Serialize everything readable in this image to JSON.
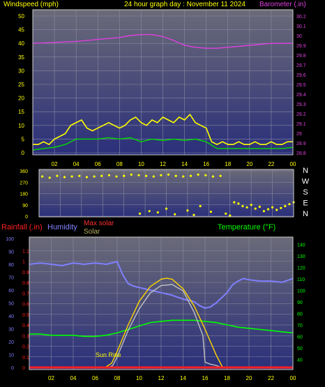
{
  "header": {
    "left_label": "Windspeed (mph)",
    "title": "24 hour graph day : November 11 2024",
    "right_label": "Barometer (.in)"
  },
  "colors": {
    "windspeed": "#ffff00",
    "wind_average": "#00dd00",
    "barometer": "#e040e0",
    "wind_direction": "#ffff00",
    "rainfall": "#ff2020",
    "humidity": "#8080ff",
    "max_solar": "#ffd700",
    "solar": "#c0c0c0",
    "temperature": "#00ff00",
    "plot_top": "#6a6a78",
    "plot_bottom": "#2a2f7a"
  },
  "x_axis_labels": [
    "02",
    "04",
    "06",
    "08",
    "10",
    "12",
    "14",
    "16",
    "18",
    "20",
    "22",
    "00"
  ],
  "chart_data": [
    {
      "type": "line",
      "panel": "wind_barometer",
      "x_unit": "hour",
      "xlim": [
        0,
        24
      ],
      "y_left_label": "Windspeed (mph)",
      "ylim_left": [
        0,
        50
      ],
      "y_left_ticks": [
        "0",
        "5",
        "10",
        "15",
        "20",
        "25",
        "30",
        "35",
        "40",
        "45",
        "50"
      ],
      "y_right_label": "Barometer (.in)",
      "ylim_right": [
        28.8,
        30.2
      ],
      "y_right_ticks": [
        "28.8",
        "28.9",
        "29",
        "29.1",
        "29.2",
        "29.3",
        "29.4",
        "29.5",
        "29.6",
        "29.7",
        "29.8",
        "29.9",
        "30",
        "30.1",
        "30.2"
      ],
      "series": [
        {
          "name": "Windspeed (mph)",
          "axis": "left",
          "x": [
            0,
            0.5,
            1,
            1.5,
            2,
            2.5,
            3,
            3.5,
            4,
            4.5,
            5,
            5.5,
            6,
            6.5,
            7,
            7.5,
            8,
            8.5,
            9,
            9.5,
            10,
            10.5,
            11,
            11.5,
            12,
            12.5,
            13,
            13.5,
            14,
            14.5,
            15,
            15.5,
            16,
            16.5,
            17,
            17.5,
            18,
            18.5,
            19,
            19.5,
            20,
            20.5,
            21,
            21.5,
            22,
            22.5,
            23,
            23.5,
            24
          ],
          "y": [
            3,
            3,
            4,
            3,
            5,
            6,
            7,
            10,
            11,
            12,
            9,
            8,
            9,
            10,
            11,
            10,
            9,
            10,
            12,
            13,
            11,
            10,
            12,
            11,
            13,
            12,
            11,
            13,
            12,
            14,
            11,
            10,
            9,
            4,
            3,
            4,
            3,
            3,
            4,
            3,
            3,
            4,
            3,
            3,
            4,
            3,
            3,
            4,
            4
          ]
        },
        {
          "name": "Average windspeed",
          "axis": "left",
          "x": [
            0,
            1,
            2,
            3,
            4,
            5,
            6,
            7,
            8,
            9,
            10,
            11,
            12,
            13,
            14,
            15,
            16,
            17,
            18,
            19,
            20,
            21,
            22,
            23,
            24
          ],
          "y": [
            1,
            1.5,
            2,
            3,
            5,
            5,
            5,
            5.5,
            5,
            5.5,
            4,
            5,
            4.5,
            5,
            4.5,
            5,
            4,
            1.5,
            1.5,
            1.5,
            1.5,
            1.5,
            1.5,
            1.5,
            2
          ]
        },
        {
          "name": "Barometer (.in)",
          "axis": "right",
          "x": [
            0,
            2,
            4,
            6,
            8,
            9,
            10,
            11,
            12,
            13,
            14,
            15,
            16,
            17,
            18,
            20,
            22,
            24
          ],
          "y": [
            29.92,
            29.93,
            29.94,
            29.96,
            29.98,
            30.0,
            30.01,
            30.01,
            29.99,
            29.95,
            29.9,
            29.88,
            29.87,
            29.87,
            29.88,
            29.9,
            29.92,
            29.92
          ]
        }
      ]
    },
    {
      "type": "scatter",
      "panel": "wind_direction",
      "x_unit": "hour",
      "xlim": [
        0,
        24
      ],
      "ylim": [
        0,
        360
      ],
      "y_ticks": [
        "0",
        "90",
        "180",
        "270",
        "360"
      ],
      "direction_labels": [
        "N",
        "W",
        "S",
        "E",
        "N"
      ],
      "series": [
        {
          "name": "Wind direction",
          "x": [
            0.3,
            1.0,
            1.7,
            2.4,
            3.1,
            3.8,
            4.5,
            5.2,
            5.9,
            6.6,
            7.3,
            8.0,
            8.7,
            9.4,
            10.1,
            10.8,
            11.5,
            12.2,
            12.9,
            13.6,
            14.3,
            15.0,
            15.7,
            16.4,
            17.1,
            9.5,
            10.4,
            11.2,
            12.0,
            12.8,
            14.0,
            14.6,
            15.2,
            16.2,
            17.6,
            18.0,
            18.4,
            18.8,
            19.2,
            19.6,
            20.0,
            20.4,
            20.8,
            21.2,
            21.6,
            22.0,
            22.4,
            22.8,
            23.2,
            23.6,
            24.0
          ],
          "y": [
            315,
            305,
            320,
            310,
            315,
            320,
            310,
            315,
            320,
            325,
            315,
            320,
            330,
            325,
            320,
            315,
            325,
            330,
            320,
            315,
            320,
            330,
            325,
            315,
            320,
            20,
            40,
            30,
            60,
            15,
            45,
            10,
            80,
            35,
            20,
            5,
            110,
            100,
            80,
            70,
            90,
            60,
            75,
            40,
            55,
            70,
            50,
            65,
            80,
            95,
            110
          ]
        }
      ]
    },
    {
      "type": "line",
      "panel": "rain_humidity_solar_temperature",
      "x_unit": "hour",
      "xlim": [
        0,
        24
      ],
      "legend": {
        "rainfall": "Rainfall (.in)",
        "humidity": "Humidity",
        "max_solar": "Max solar",
        "solar": "Solar",
        "temperature": "Temperature (°F)"
      },
      "annotation": "Sun Rise",
      "rain_ticks": [
        "0",
        "0.1",
        "0.2",
        "0.3",
        "0.4",
        "0.5",
        "0.6",
        "0.7",
        "0.8",
        "0.9",
        "1",
        "1.1"
      ],
      "ylim_rain": [
        0,
        1.2
      ],
      "humidity_ticks": [
        "0",
        "10",
        "20",
        "30",
        "40",
        "50",
        "60",
        "70",
        "80",
        "90",
        "100"
      ],
      "ylim_humidity": [
        0,
        100
      ],
      "temperature_ticks": [
        "40",
        "50",
        "60",
        "70",
        "80",
        "90",
        "100",
        "110",
        "120",
        "130",
        "140"
      ],
      "ylim_temperature": [
        33,
        145
      ],
      "series": [
        {
          "name": "Humidity",
          "axis": "humidity",
          "x": [
            0,
            1,
            2,
            3,
            4,
            5,
            6,
            7,
            7.5,
            8,
            8.5,
            9,
            9.5,
            10,
            11,
            12,
            13,
            14,
            15,
            15.5,
            16,
            16.5,
            17,
            17.5,
            18,
            18.5,
            19,
            19.5,
            20,
            21,
            22,
            23,
            24
          ],
          "y": [
            80,
            81,
            80,
            79,
            81,
            80,
            81,
            80,
            81,
            82,
            72,
            65,
            63,
            62,
            60,
            58,
            56,
            53,
            51,
            48,
            46,
            47,
            50,
            54,
            58,
            64,
            67,
            69,
            68,
            67,
            67,
            66,
            69
          ]
        },
        {
          "name": "Temperature (°F)",
          "axis": "temperature",
          "x": [
            0,
            1,
            2,
            3,
            4,
            5,
            6,
            7,
            8,
            9,
            10,
            11,
            12,
            13,
            14,
            15,
            16,
            17,
            18,
            19,
            20,
            21,
            22,
            23,
            24
          ],
          "y": [
            62,
            62,
            61,
            61,
            61,
            60,
            60,
            61,
            63,
            66,
            69,
            72,
            73,
            74,
            74,
            74,
            73,
            72,
            70,
            68,
            67,
            66,
            65,
            64,
            63
          ]
        },
        {
          "name": "Max solar",
          "axis": "rain",
          "x": [
            6.9,
            7.5,
            8,
            9,
            10,
            11,
            12,
            12.5,
            13,
            14,
            15,
            16,
            17,
            17.6
          ],
          "y": [
            0,
            0.04,
            0.15,
            0.4,
            0.62,
            0.76,
            0.83,
            0.84,
            0.83,
            0.74,
            0.58,
            0.36,
            0.12,
            0
          ]
        },
        {
          "name": "Solar",
          "axis": "rain",
          "x": [
            7.3,
            7.6,
            8,
            9,
            10,
            11,
            12,
            13,
            14,
            15,
            15.8,
            16,
            16.5,
            17,
            17.5
          ],
          "y": [
            0,
            0.02,
            0.1,
            0.35,
            0.55,
            0.7,
            0.77,
            0.78,
            0.72,
            0.52,
            0.3,
            0.05,
            0.03,
            0.02,
            0
          ]
        },
        {
          "name": "Rainfall (.in)",
          "axis": "rain",
          "x": [
            0,
            24
          ],
          "y": [
            0,
            0
          ]
        }
      ]
    }
  ]
}
